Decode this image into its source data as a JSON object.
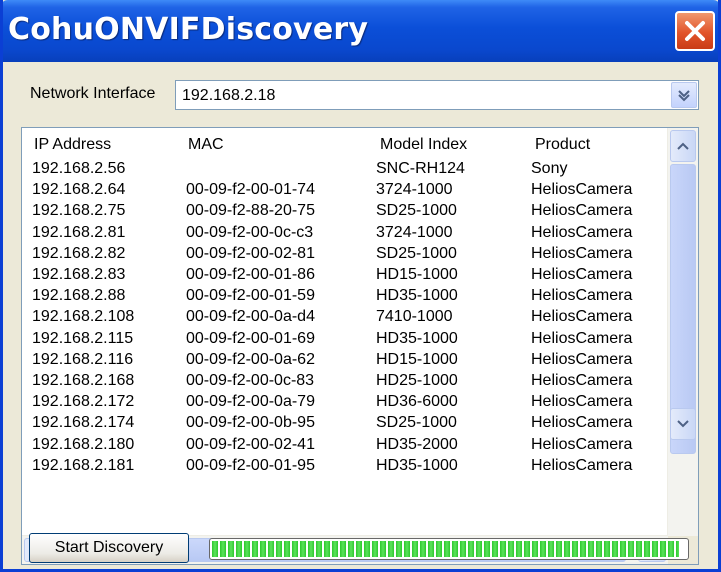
{
  "window": {
    "title": "CohuONVIFDiscovery"
  },
  "network": {
    "label": "Network Interface",
    "value": "192.168.2.18"
  },
  "list": {
    "columns": [
      "IP Address",
      "MAC",
      "Model Index",
      "Product"
    ],
    "rows": [
      [
        "192.168.2.56",
        "",
        "SNC-RH124",
        "Sony"
      ],
      [
        "192.168.2.64",
        "00-09-f2-00-01-74",
        "3724-1000",
        "HeliosCamera"
      ],
      [
        "192.168.2.75",
        "00-09-f2-88-20-75",
        "SD25-1000",
        "HeliosCamera"
      ],
      [
        "192.168.2.81",
        "00-09-f2-00-0c-c3",
        "3724-1000",
        "HeliosCamera"
      ],
      [
        "192.168.2.82",
        "00-09-f2-00-02-81",
        "SD25-1000",
        "HeliosCamera"
      ],
      [
        "192.168.2.83",
        "00-09-f2-00-01-86",
        "HD15-1000",
        "HeliosCamera"
      ],
      [
        "192.168.2.88",
        "00-09-f2-00-01-59",
        "HD35-1000",
        "HeliosCamera"
      ],
      [
        "192.168.2.108",
        "00-09-f2-00-0a-d4",
        "7410-1000",
        "HeliosCamera"
      ],
      [
        "192.168.2.115",
        "00-09-f2-00-01-69",
        "HD35-1000",
        "HeliosCamera"
      ],
      [
        "192.168.2.116",
        "00-09-f2-00-0a-62",
        "HD15-1000",
        "HeliosCamera"
      ],
      [
        "192.168.2.168",
        "00-09-f2-00-0c-83",
        "HD25-1000",
        "HeliosCamera"
      ],
      [
        "192.168.2.172",
        "00-09-f2-00-0a-79",
        "HD36-6000",
        "HeliosCamera"
      ],
      [
        "192.168.2.174",
        "00-09-f2-00-0b-95",
        "SD25-1000",
        "HeliosCamera"
      ],
      [
        "192.168.2.180",
        "00-09-f2-00-02-41",
        "HD35-2000",
        "HeliosCamera"
      ],
      [
        "192.168.2.181",
        "00-09-f2-00-01-95",
        "HD35-1000",
        "HeliosCamera"
      ]
    ]
  },
  "actions": {
    "start_label": "Start Discovery"
  },
  "progress": {
    "fraction": 0.99
  },
  "icons": {
    "close": "close-icon",
    "dropdown": "chevron-down-icon",
    "scroll_up": "chevron-up-icon",
    "scroll_down": "chevron-down-icon",
    "scroll_left": "chevron-left-icon",
    "scroll_right": "chevron-right-icon"
  },
  "colors": {
    "titlebar": "#0b4fd8",
    "close_button": "#e2542a",
    "progress": "#2ec82e"
  }
}
